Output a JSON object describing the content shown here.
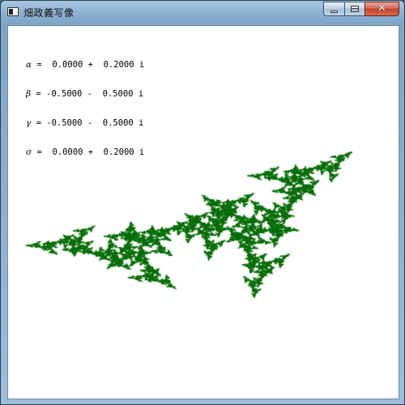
{
  "window": {
    "title": "畑政義写像"
  },
  "parameters": [
    {
      "symbol": "α",
      "text": " =  0.0000 +  0.2000 i"
    },
    {
      "symbol": "β",
      "text": " = -0.5000 -  0.5000 i"
    },
    {
      "symbol": "γ",
      "text": " = -0.5000 -  0.5000 i"
    },
    {
      "symbol": "σ",
      "text": " =  0.0000 +  0.2000 i"
    }
  ],
  "caption_buttons": {
    "minimize_icon": "minimize-icon",
    "maximize_icon": "maximize-icon",
    "close_icon": "close-icon"
  },
  "colors": {
    "fractal": "#0a6e0a"
  }
}
